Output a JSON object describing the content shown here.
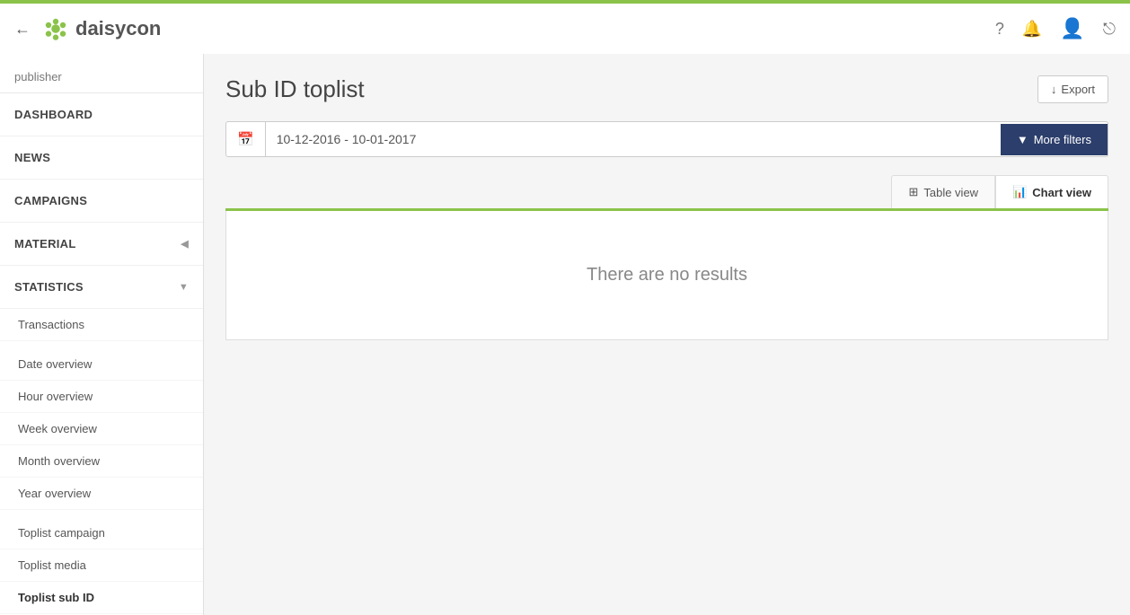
{
  "topbar": {
    "logo_text": "daisycon",
    "back_label": "←",
    "help_icon": "?",
    "announce_icon": "📢",
    "user_icon": "👤",
    "logout_icon": "⎋"
  },
  "sidebar": {
    "publisher_label": "publisher",
    "nav_items": [
      {
        "id": "dashboard",
        "label": "DASHBOARD",
        "has_children": false
      },
      {
        "id": "news",
        "label": "NEWS",
        "has_children": false
      },
      {
        "id": "campaigns",
        "label": "CAMPAIGNS",
        "has_children": false
      },
      {
        "id": "material",
        "label": "MATERIAL",
        "has_children": true,
        "expanded": false
      },
      {
        "id": "statistics",
        "label": "STATISTICS",
        "has_children": true,
        "expanded": true
      }
    ],
    "statistics_sub_items": [
      {
        "id": "transactions",
        "label": "Transactions",
        "active": false
      },
      {
        "id": "date-overview",
        "label": "Date overview",
        "active": false
      },
      {
        "id": "hour-overview",
        "label": "Hour overview",
        "active": false
      },
      {
        "id": "week-overview",
        "label": "Week overview",
        "active": false
      },
      {
        "id": "month-overview",
        "label": "Month overview",
        "active": false
      },
      {
        "id": "year-overview",
        "label": "Year overview",
        "active": false
      }
    ],
    "toplist_items": [
      {
        "id": "toplist-campaign",
        "label": "Toplist campaign",
        "active": false
      },
      {
        "id": "toplist-media",
        "label": "Toplist media",
        "active": false
      },
      {
        "id": "toplist-sub-id",
        "label": "Toplist sub ID",
        "active": true
      }
    ]
  },
  "page": {
    "title": "Sub ID toplist",
    "export_label": "Export",
    "export_icon": "↓"
  },
  "filters": {
    "date_range": "10-12-2016 - 10-01-2017",
    "more_filters_label": "More filters",
    "filter_icon": "▼"
  },
  "view_tabs": [
    {
      "id": "table-view",
      "label": "Table view",
      "icon": "⊞",
      "active": false
    },
    {
      "id": "chart-view",
      "label": "Chart view",
      "icon": "📊",
      "active": true
    }
  ],
  "results": {
    "empty_message": "There are no results"
  }
}
